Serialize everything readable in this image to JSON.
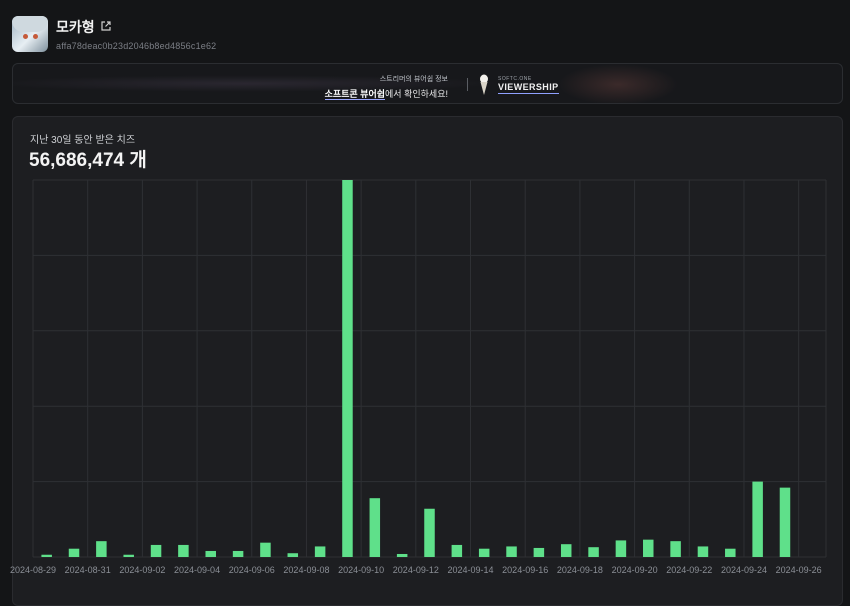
{
  "profile": {
    "name": "모카형",
    "id": "affa78deac0b23d2046b8ed4856c1e62"
  },
  "banner": {
    "line1": "스트리머의 뷰어쉽 정보",
    "line2_bold": "소프트콘 뷰어쉽",
    "line2_rest": "에서 확인하세요!",
    "brand_small": "SOFTC.ONE",
    "brand_big": "VIEWERSHIP"
  },
  "summary": {
    "title": "지난 30일 동안 받은 치즈",
    "total": "56,686,474 개"
  },
  "colors": {
    "bar": "#5fe08a",
    "grid": "#2e3034",
    "background": "#141517"
  },
  "chart_data": {
    "type": "bar",
    "x": [
      "2024-08-29",
      "2024-08-30",
      "2024-08-31",
      "2024-09-01",
      "2024-09-02",
      "2024-09-03",
      "2024-09-04",
      "2024-09-05",
      "2024-09-06",
      "2024-09-07",
      "2024-09-08",
      "2024-09-09",
      "2024-09-10",
      "2024-09-11",
      "2024-09-12",
      "2024-09-13",
      "2024-09-14",
      "2024-09-15",
      "2024-09-16",
      "2024-09-17",
      "2024-09-18",
      "2024-09-19",
      "2024-09-20",
      "2024-09-21",
      "2024-09-22",
      "2024-09-23",
      "2024-09-24",
      "2024-09-25",
      "2024-09-26"
    ],
    "x_tick_labels": [
      "2024-08-29",
      "2024-08-31",
      "2024-09-02",
      "2024-09-04",
      "2024-09-06",
      "2024-09-08",
      "2024-09-10",
      "2024-09-12",
      "2024-09-14",
      "2024-09-16",
      "2024-09-18",
      "2024-09-20",
      "2024-09-22",
      "2024-09-24",
      "2024-09-26"
    ],
    "values": [
      0.3,
      1.1,
      2.1,
      0.3,
      1.6,
      1.6,
      0.8,
      0.8,
      1.9,
      0.5,
      1.4,
      50.0,
      7.8,
      0.4,
      6.4,
      1.6,
      1.1,
      1.4,
      1.2,
      1.7,
      1.3,
      2.2,
      2.3,
      2.1,
      1.4,
      1.1,
      10.0,
      9.2,
      0
    ],
    "ylim": [
      0,
      50
    ],
    "y_grid_step": 10,
    "grid": true,
    "legend": "none"
  }
}
